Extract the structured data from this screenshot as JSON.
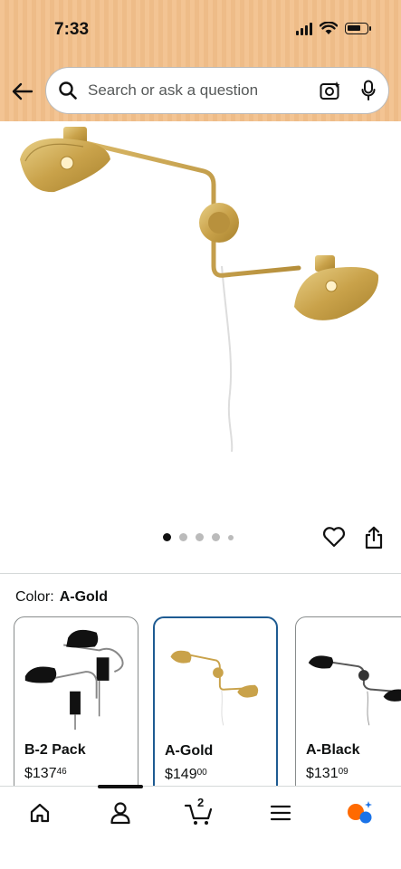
{
  "status": {
    "time": "7:33"
  },
  "search": {
    "placeholder": "Search or ask a question"
  },
  "gallery": {
    "image_count": 5,
    "active_index": 0
  },
  "product": {
    "color_label": "Color:",
    "color_value": "A-Gold"
  },
  "swatches": [
    {
      "name": "B-2 Pack",
      "price_dollars": "$137",
      "price_cents": "46",
      "selected": false
    },
    {
      "name": "A-Gold",
      "price_dollars": "$149",
      "price_cents": "00",
      "selected": true
    },
    {
      "name": "A-Black",
      "price_dollars": "$131",
      "price_cents": "09",
      "selected": false
    }
  ],
  "nav": {
    "cart_count": "2",
    "active": "account"
  },
  "colors": {
    "header": "#f3c493",
    "brass": "#c9a24a",
    "selected_border": "#1e5b92",
    "accent_orange": "#ff6a00"
  }
}
